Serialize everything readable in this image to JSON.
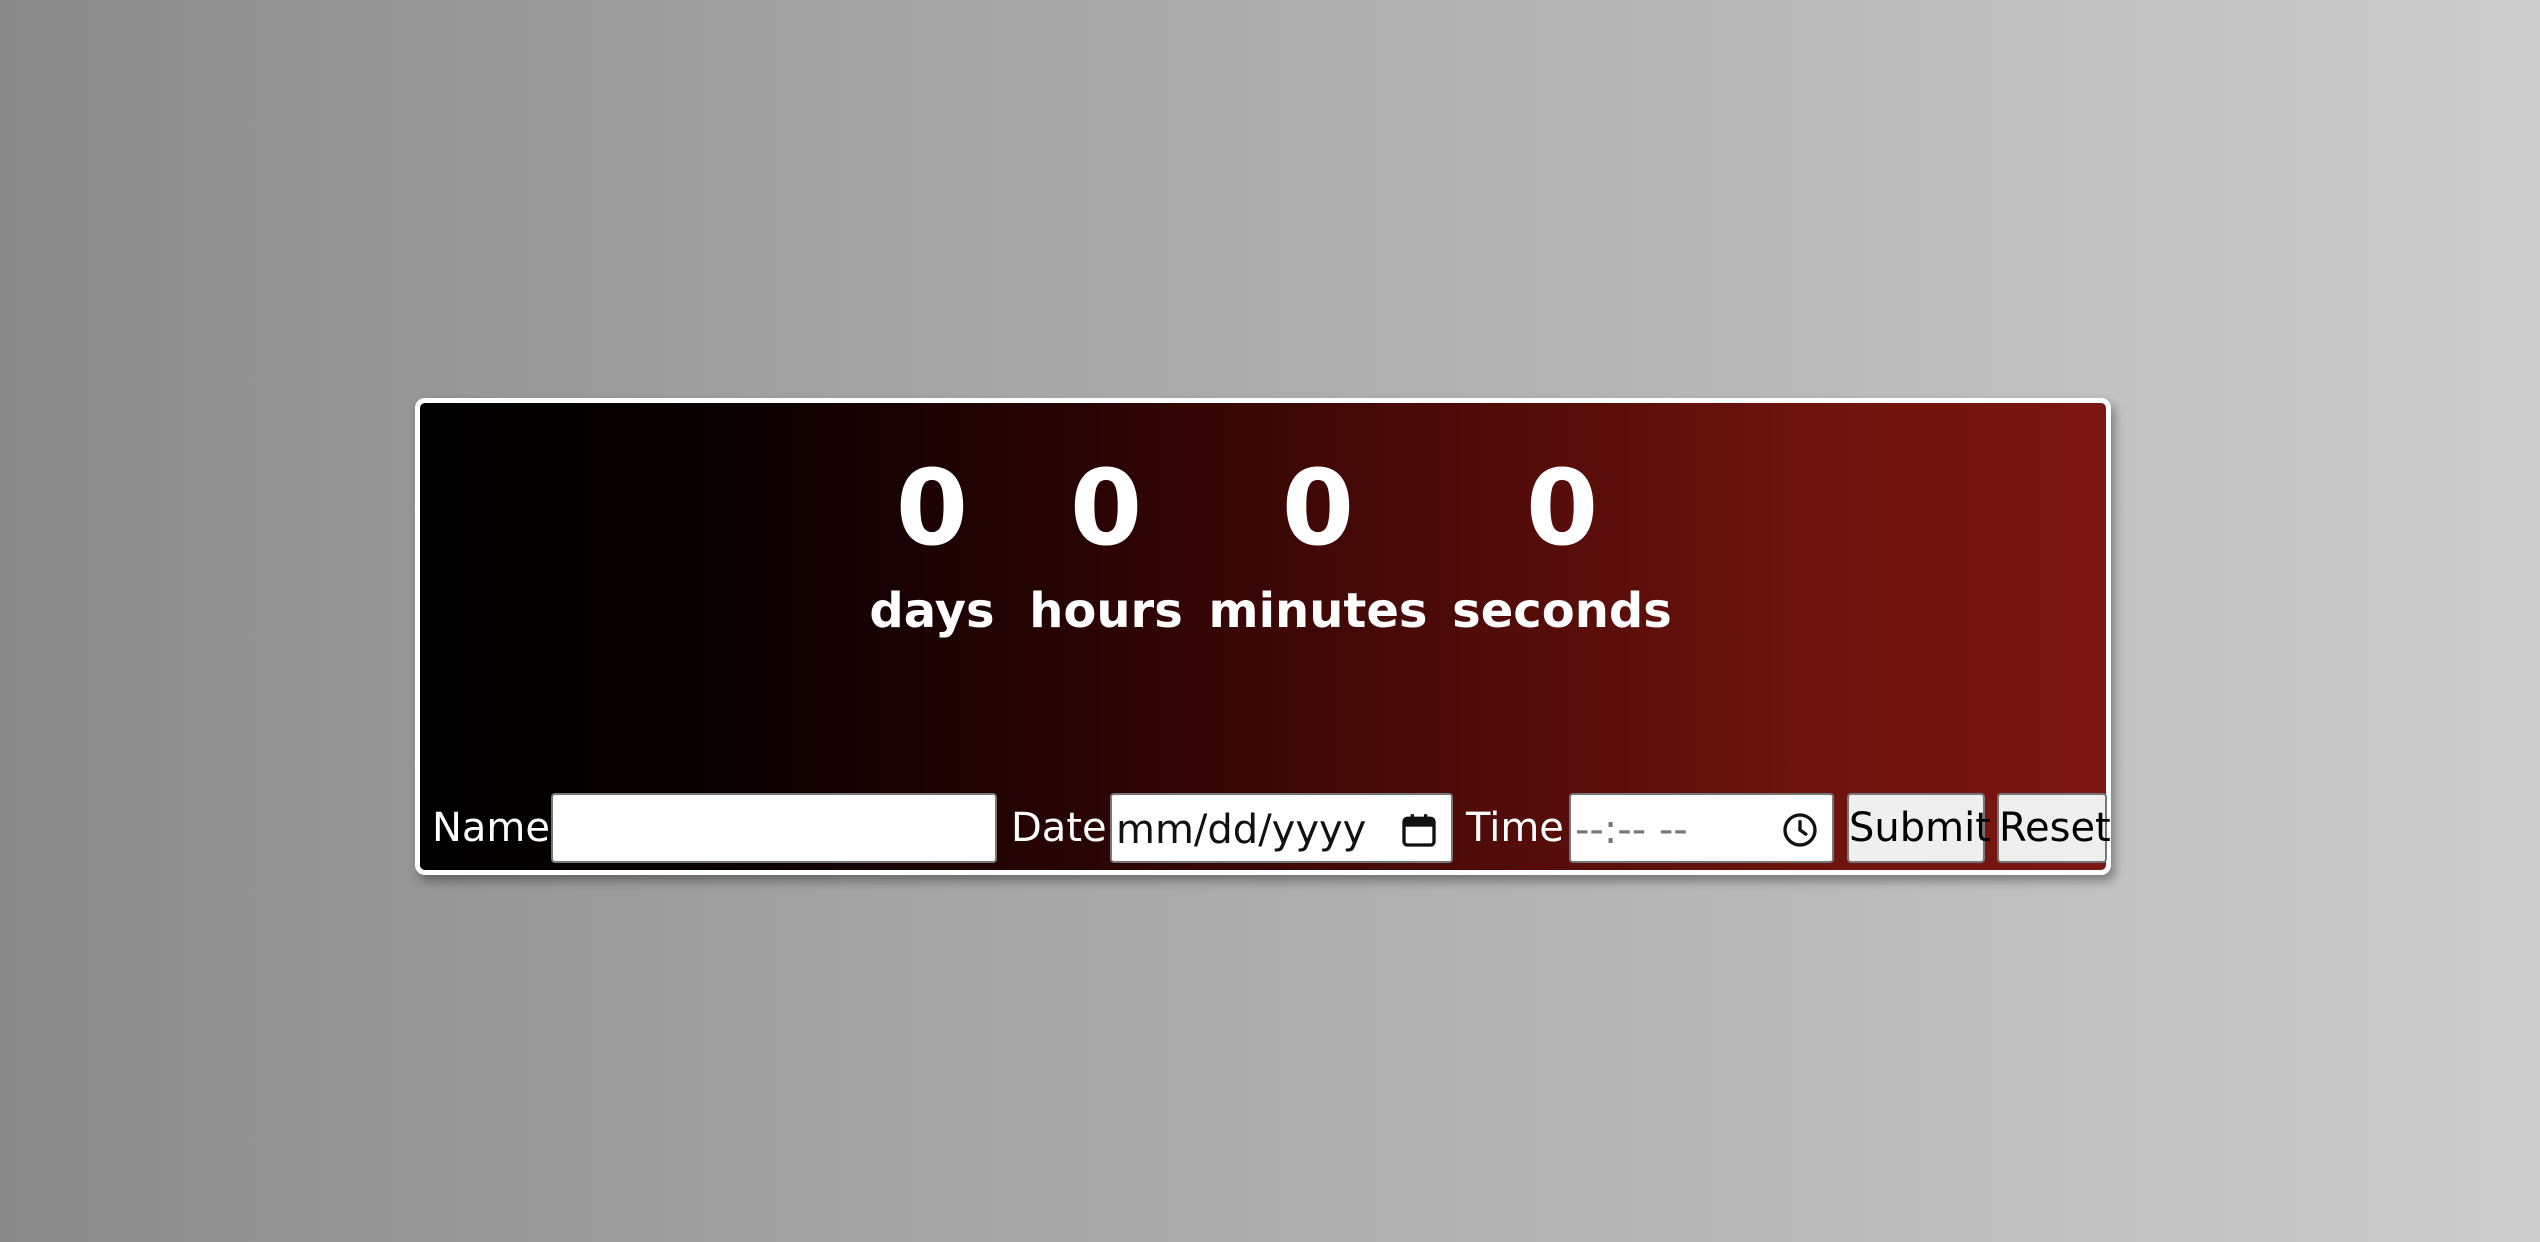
{
  "countdown": {
    "days": {
      "value": "0",
      "label": "days"
    },
    "hours": {
      "value": "0",
      "label": "hours"
    },
    "minutes": {
      "value": "0",
      "label": "minutes"
    },
    "seconds": {
      "value": "0",
      "label": "seconds"
    }
  },
  "form": {
    "name_label": "Name",
    "name_value": "",
    "date_label": "Date",
    "date_placeholder": "mm/dd/yyyy",
    "time_label": "Time",
    "time_placeholder": "--:-- --",
    "submit_label": "Submit",
    "reset_label": "Reset"
  },
  "icons": {
    "date": "calendar-icon",
    "time": "clock-icon"
  },
  "colors": {
    "card_gradient_start": "#000000",
    "card_gradient_end": "#7d1610",
    "card_border": "#ffffff",
    "text": "#ffffff"
  }
}
